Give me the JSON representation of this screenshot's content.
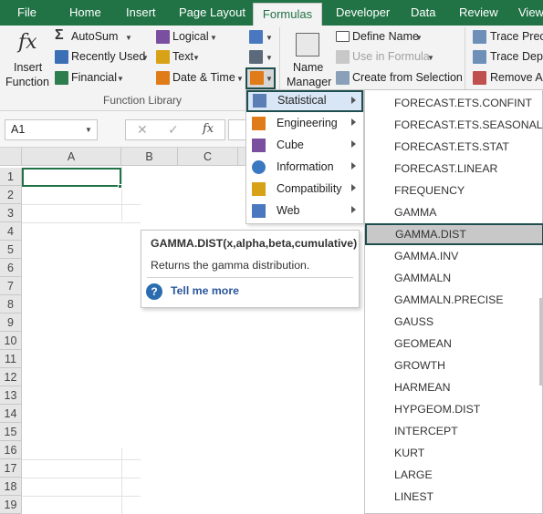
{
  "tabs": [
    "File",
    "Home",
    "Insert",
    "Page Layout",
    "Formulas",
    "Developer",
    "Data",
    "Review",
    "View"
  ],
  "active_tab": "Formulas",
  "ribbon": {
    "insert_function": {
      "icon_text": "fx",
      "line1": "Insert",
      "line2": "Function"
    },
    "autosum": "AutoSum",
    "recently_used": "Recently Used",
    "financial": "Financial",
    "logical": "Logical",
    "text": "Text",
    "date_time": "Date & Time",
    "name_manager": {
      "line1": "Name",
      "line2": "Manager"
    },
    "define_name": "Define Name",
    "use_in_formula": "Use in Formula",
    "create_from_selection": "Create from Selection",
    "trace_precedents": "Trace Precedents",
    "trace_dependents": "Trace Dependents",
    "remove_arrows": "Remove Arrows",
    "group_function_library": "Function Library"
  },
  "formula_bar": {
    "name_box": "A1",
    "cancel_symbol": "✕",
    "enter_symbol": "✓",
    "fx_symbol": "fx"
  },
  "grid": {
    "columns": [
      "A",
      "B",
      "C"
    ],
    "rows": [
      "1",
      "2",
      "3",
      "4",
      "5",
      "6",
      "7",
      "8",
      "9",
      "10",
      "11",
      "12",
      "13",
      "14",
      "15",
      "16",
      "17",
      "18",
      "19"
    ]
  },
  "more_functions_menu": {
    "items": [
      {
        "label": "Statistical",
        "icon": "statistical-icon",
        "color": "#5b7fb5"
      },
      {
        "label": "Engineering",
        "icon": "engineering-icon",
        "color": "#e07b1a"
      },
      {
        "label": "Cube",
        "icon": "cube-icon",
        "color": "#7b4fa0"
      },
      {
        "label": "Information",
        "icon": "information-icon",
        "color": "#3a79c1"
      },
      {
        "label": "Compatibility",
        "icon": "compatibility-icon",
        "color": "#d8a218"
      },
      {
        "label": "Web",
        "icon": "web-icon",
        "color": "#4a78c0"
      }
    ],
    "highlighted": "Statistical"
  },
  "statistical_menu": {
    "items": [
      "FORECAST.ETS.CONFINT",
      "FORECAST.ETS.SEASONALITY",
      "FORECAST.ETS.STAT",
      "FORECAST.LINEAR",
      "FREQUENCY",
      "GAMMA",
      "GAMMA.DIST",
      "GAMMA.INV",
      "GAMMALN",
      "GAMMALN.PRECISE",
      "GAUSS",
      "GEOMEAN",
      "GROWTH",
      "HARMEAN",
      "HYPGEOM.DIST",
      "INTERCEPT",
      "KURT",
      "LARGE",
      "LINEST"
    ],
    "highlighted": "GAMMA.DIST"
  },
  "tooltip": {
    "title": "GAMMA.DIST(x,alpha,beta,cumulative)",
    "description": "Returns the gamma distribution.",
    "help_symbol": "?",
    "link": "Tell me more"
  },
  "colors": {
    "brand": "#217346",
    "menu_highlight_border": "#1f4e4e"
  }
}
